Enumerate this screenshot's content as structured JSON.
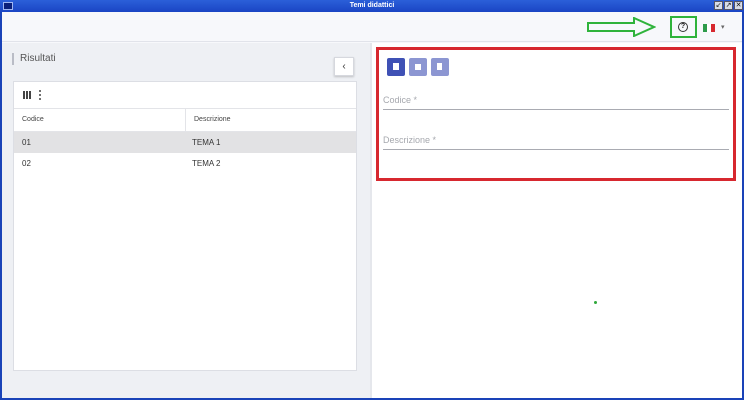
{
  "window": {
    "title": "Temi didattici",
    "controls": [
      "↙",
      "↗",
      "✕"
    ]
  },
  "topbar": {
    "help_icon": "help-circle-icon",
    "help_glyph": "?",
    "language_flag": "italy-flag",
    "flag_colors": [
      "#2d9b4a",
      "#ffffff",
      "#d7282f"
    ],
    "caret": "▾"
  },
  "left_panel": {
    "section_title": "Risultati",
    "collapse_glyph": "‹",
    "table": {
      "columns": [
        "Codice",
        "Descrizione"
      ],
      "rows": [
        {
          "code": "01",
          "description": "TEMA 1",
          "selected": true
        },
        {
          "code": "02",
          "description": "TEMA 2",
          "selected": false
        }
      ]
    }
  },
  "right_panel": {
    "toolbar": [
      "new-document-icon",
      "save-icon",
      "delete-icon"
    ],
    "fields": {
      "code_placeholder": "Codice *",
      "description_placeholder": "Descrizione *"
    }
  },
  "annotations": {
    "highlight_color": "#d7282f",
    "arrow_color": "#2fb33b"
  }
}
